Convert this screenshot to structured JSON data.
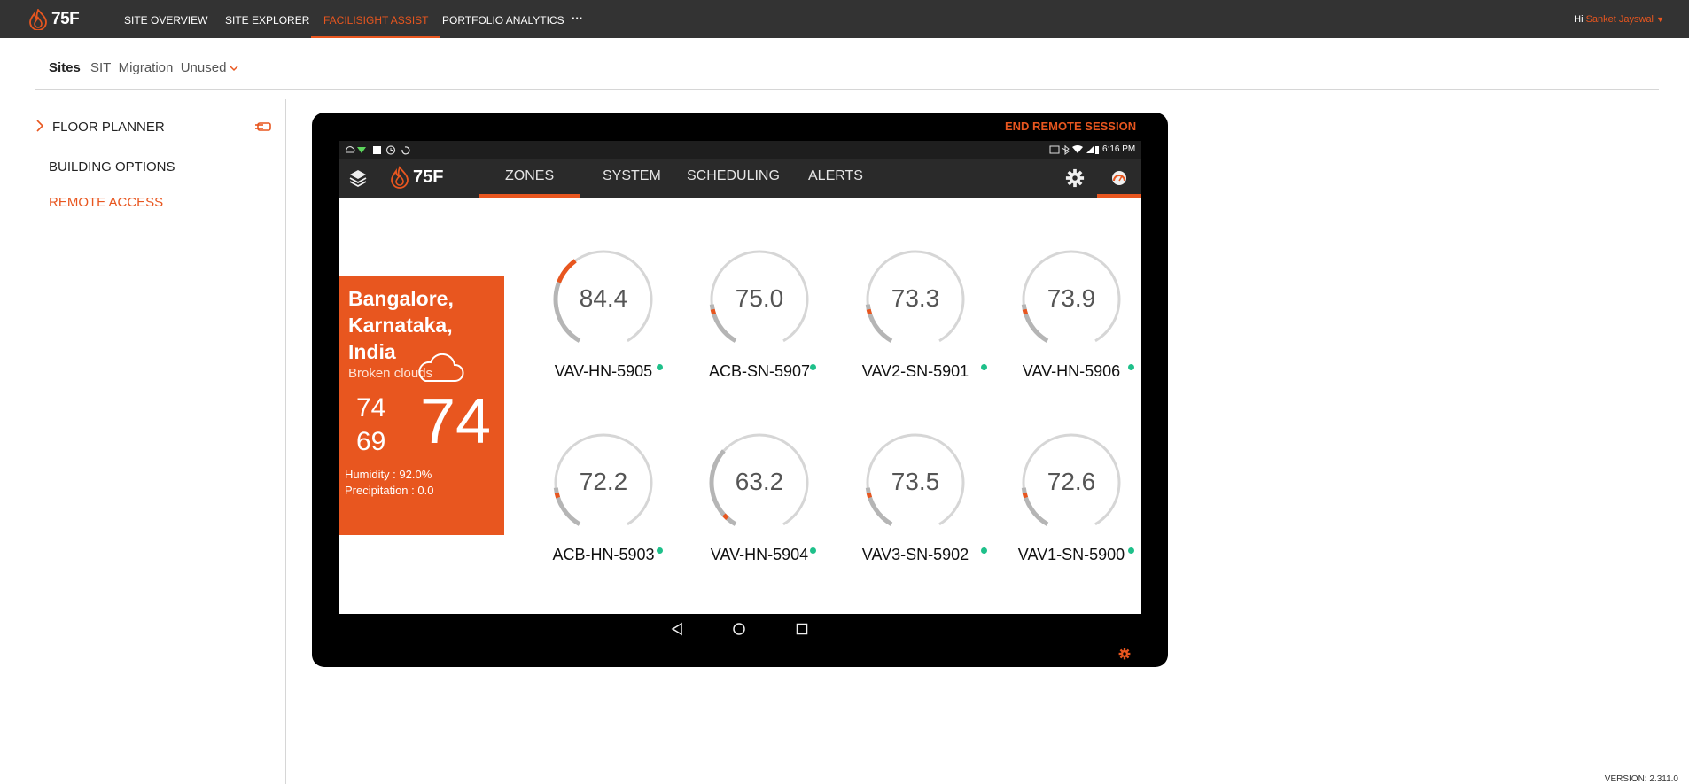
{
  "nav": {
    "brand": "75F",
    "items": [
      "SITE OVERVIEW",
      "SITE EXPLORER",
      "FACILISIGHT ASSIST",
      "PORTFOLIO ANALYTICS"
    ],
    "more": "···",
    "greeting": "Hi",
    "user": "Sanket Jayswal"
  },
  "sites": {
    "label": "Sites",
    "value": "SIT_Migration_Unused"
  },
  "sidebar": {
    "floor_planner": "FLOOR PLANNER",
    "building_options": "BUILDING OPTIONS",
    "remote_access": "REMOTE ACCESS"
  },
  "tablet": {
    "end_session": "END REMOTE SESSION",
    "time": "6:16 PM",
    "brand": "75F",
    "tabs": [
      "ZONES",
      "SYSTEM",
      "SCHEDULING",
      "ALERTS"
    ],
    "active_tab": "ZONES",
    "weather": {
      "location": [
        "Bangalore,",
        "Karnataka,",
        "India"
      ],
      "condition": "Broken clouds",
      "high": "74",
      "low": "69",
      "current": "74",
      "humidity": "Humidity : 92.0%",
      "precipitation": "Precipitation : 0.0"
    },
    "zones": [
      {
        "value": "84.4",
        "name": "VAV-HN-5905",
        "status": "online"
      },
      {
        "value": "75.0",
        "name": "ACB-SN-5907",
        "status": "online"
      },
      {
        "value": "73.3",
        "name": "VAV2-SN-5901",
        "status": "online"
      },
      {
        "value": "73.9",
        "name": "VAV-HN-5906",
        "status": "online"
      },
      {
        "value": "72.2",
        "name": "ACB-HN-5903",
        "status": "online"
      },
      {
        "value": "63.2",
        "name": "VAV-HN-5904",
        "status": "online"
      },
      {
        "value": "73.5",
        "name": "VAV3-SN-5902",
        "status": "online"
      },
      {
        "value": "72.6",
        "name": "VAV1-SN-5900",
        "status": "online"
      }
    ]
  },
  "version": "VERSION: 2.311.0",
  "colors": {
    "accent": "#e8561f",
    "nav_bg": "#333333",
    "online": "#1ec08a"
  }
}
